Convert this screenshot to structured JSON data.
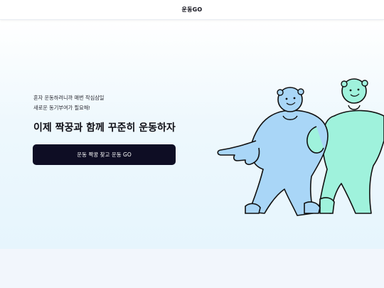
{
  "header": {
    "logo_text": "운동GO"
  },
  "hero": {
    "subtitle_line1": "혼자 운동하려니까 매번 작심삼일",
    "subtitle_line2": "새로운 동기부여가 필요해!",
    "headline": "이제 짝꿍과 함께 꾸준히 운동하자",
    "cta_label": "운동 짝꿍 찾고 운동 GO"
  },
  "colors": {
    "cta_background": "#0e0d24",
    "character_blue": "#a9d6f7",
    "character_mint": "#9ff2dc",
    "outline": "#111111"
  }
}
